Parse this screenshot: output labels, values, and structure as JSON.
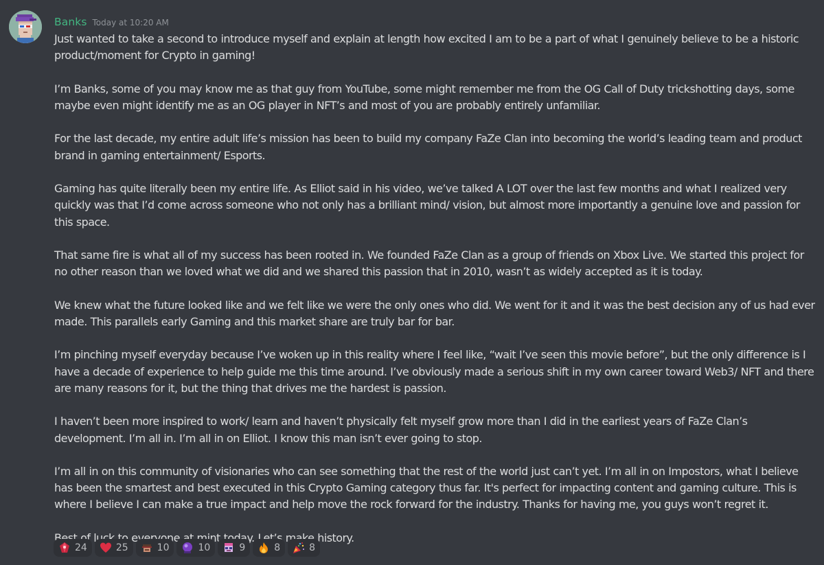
{
  "message": {
    "author": "Banks",
    "timestamp": "Today at 10:20 AM",
    "author_color": "#43b581",
    "paragraphs": [
      "Just wanted to take a second to introduce myself and explain at length how excited I am to be a part of what I genuinely believe to be a historic product/moment for Crypto in gaming!",
      "I’m Banks, some of you may know me as that guy from YouTube, some might remember me from the OG Call of Duty trickshotting days, some maybe even might identify me as an OG player in NFT’s and most of you are probably entirely unfamiliar.",
      "For the last decade, my entire adult life’s mission has been to build my company FaZe Clan into becoming the world’s leading team and product brand in gaming entertainment/ Esports.",
      "Gaming has quite literally been my entire life. As Elliot said in his video, we’ve talked A LOT over the last few months and what I realized very quickly was that I’d come across someone who not only has a brilliant mind/ vision, but almost more importantly a genuine love and passion for this space.",
      "That same fire is what all of my success has been rooted in. We founded FaZe Clan as a group of friends on Xbox Live. We started this project for no other reason than we loved what we did and we shared this passion that in 2010, wasn’t as widely accepted as it is today.",
      "We knew what the future looked like and we felt like we were the only ones who did. We went for it and it was the best decision any of us had ever made. This parallels early Gaming and this market share are truly bar for bar.",
      "I’m pinching myself everyday because I’ve woken up in this reality where I feel like, “wait I’ve seen this movie before”, but the only difference is I have a decade of experience to help guide me this time around. I’ve obviously made a serious shift in my own career toward Web3/ NFT and there are many reasons for it, but the thing that drives me the hardest is passion.",
      "I haven’t been more inspired to work/ learn and haven’t physically felt myself grow more than I did in the earliest years of FaZe Clan’s development. I’m all in. I’m all in on Elliot. I know this man isn’t ever going to stop.",
      "I’m all in on this community of visionaries who can see something that the rest of the world just can’t yet. I’m all in on Impostors, what I believe has been the smartest and best executed in this Crypto Gaming category thus far. It's perfect for impacting content and gaming culture. This is where I believe I can make a true impact and help move the rock forward for the industry. Thanks for having me, you guys won’t regret it.",
      "Best of luck to everyone at mint today. Let’s make history."
    ]
  },
  "reactions": [
    {
      "icon": "red-gem-icon",
      "count": "24"
    },
    {
      "icon": "red-heart-icon",
      "count": "25"
    },
    {
      "icon": "character-face-icon",
      "count": "10"
    },
    {
      "icon": "purple-orb-icon",
      "count": "10"
    },
    {
      "icon": "character-mask-icon",
      "count": "9"
    },
    {
      "icon": "fire-icon",
      "count": "8"
    },
    {
      "icon": "party-popper-icon",
      "count": "8"
    }
  ],
  "colors": {
    "background": "#36393f",
    "text": "#dcddde",
    "timestamp": "#8e9297",
    "reaction_bg": "#2f3136"
  }
}
